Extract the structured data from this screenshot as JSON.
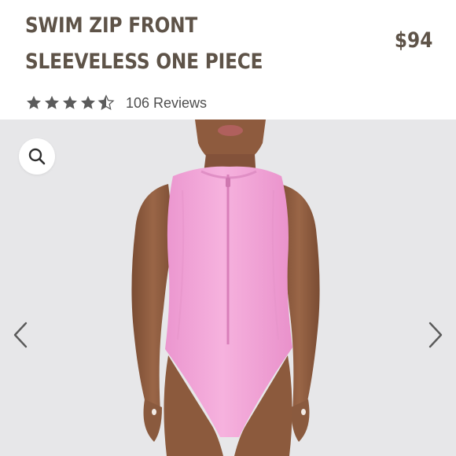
{
  "product": {
    "title": "SWIM ZIP FRONT SLEEVELESS ONE PIECE",
    "price": "$94",
    "rating": 4.5,
    "rating_max": 5,
    "reviews_label": "106 Reviews"
  },
  "colors": {
    "text": "#5e5348",
    "star": "#5b5b5b",
    "gallery_bg": "#e7e7e9",
    "swimsuit": "#f3a7d8",
    "skin": "#8b5a3c"
  },
  "icons": {
    "zoom": "search-icon",
    "prev": "chevron-left-icon",
    "next": "chevron-right-icon"
  }
}
